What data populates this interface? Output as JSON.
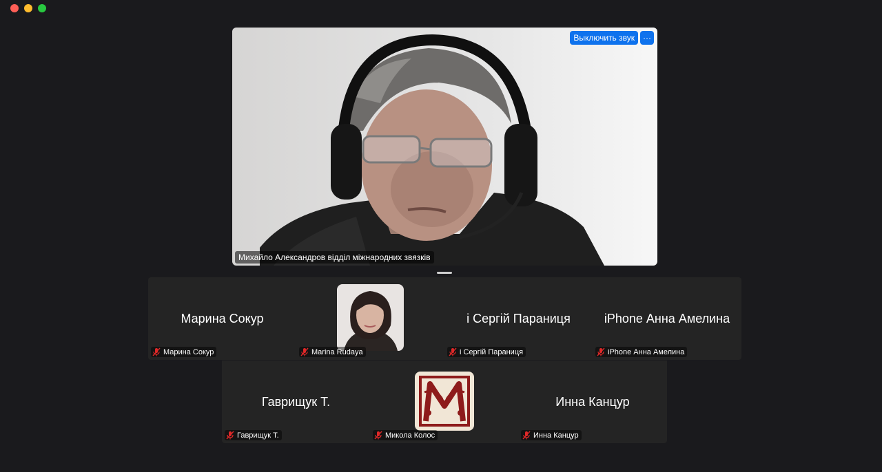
{
  "window": {
    "controls": [
      "close",
      "minimize",
      "maximize"
    ]
  },
  "speaker": {
    "name": "Михайло Александров відділ міжнародних звязків",
    "unmute_label": "Выключить звук",
    "more_label": "···"
  },
  "participants_row1": [
    {
      "display": "Марина Сокур",
      "label": "Марина Сокур",
      "muted": true,
      "avatar": null
    },
    {
      "display": "",
      "label": "Marina Rudaya",
      "muted": true,
      "avatar": "photo"
    },
    {
      "display": "і Сергій Параниця",
      "label": "і Сергій Параниця",
      "muted": true,
      "avatar": null
    },
    {
      "display": "iPhone Анна Амелина",
      "label": "iPhone Анна Амелина",
      "muted": true,
      "avatar": null
    }
  ],
  "participants_row2": [
    {
      "display": "Гаврищук Т.",
      "label": "Гаврищук Т.",
      "muted": true,
      "avatar": null
    },
    {
      "display": "",
      "label": "Микола Колос",
      "muted": true,
      "avatar": "monogram"
    },
    {
      "display": "Инна Канцур",
      "label": "Инна Канцур",
      "muted": true,
      "avatar": null
    }
  ],
  "colors": {
    "accent": "#0e72ed",
    "muted_mic": "#e02828",
    "tile_bg": "#242424",
    "app_bg": "#1a1a1d"
  }
}
